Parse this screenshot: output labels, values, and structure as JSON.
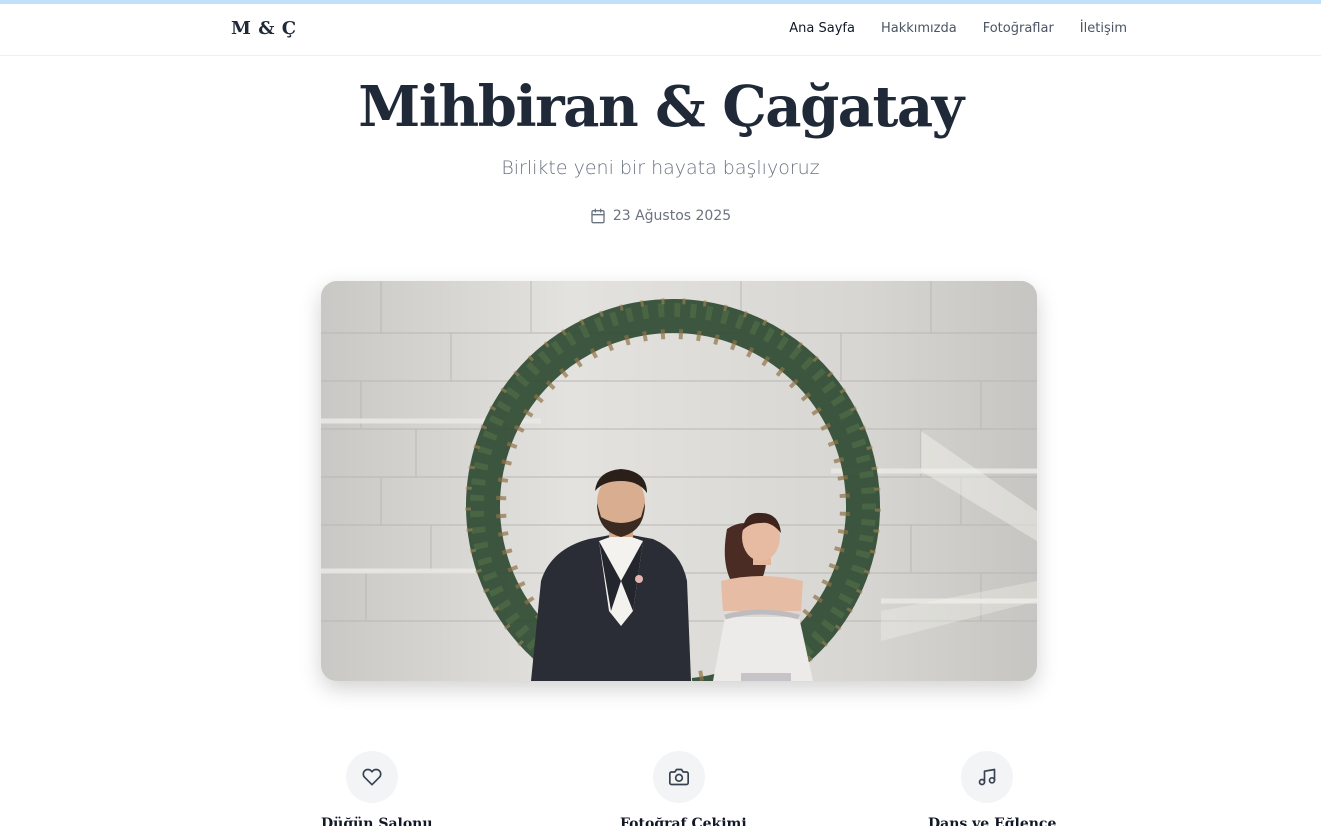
{
  "nav": {
    "logo": "M & Ç",
    "links": [
      {
        "label": "Ana Sayfa",
        "active": true
      },
      {
        "label": "Hakkımızda",
        "active": false
      },
      {
        "label": "Fotoğraflar",
        "active": false
      },
      {
        "label": "İletişim",
        "active": false
      }
    ]
  },
  "hero": {
    "title": "Mihbiran & Çağatay",
    "subtitle": "Birlikte yeni bir hayata başlıyoruz",
    "date": "23 Ağustos 2025",
    "date_icon": "calendar-icon"
  },
  "photo": {
    "subject": "wedding-couple-photo"
  },
  "features": [
    {
      "icon": "heart-icon",
      "title": "Düğün Salonu"
    },
    {
      "icon": "camera-icon",
      "title": "Fotoğraf Çekimi"
    },
    {
      "icon": "music-icon",
      "title": "Dans ve Eğlence"
    }
  ],
  "colors": {
    "accent_bar": "#bfe0fb",
    "heading": "#1f2937",
    "muted": "#6b7280",
    "icon_bg": "#f3f4f6"
  }
}
